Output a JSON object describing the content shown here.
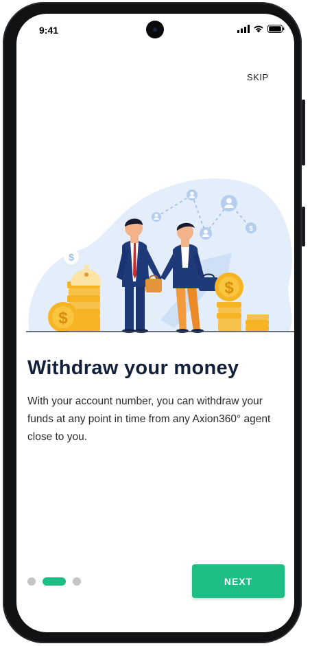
{
  "status_bar": {
    "time": "9:41"
  },
  "onboarding": {
    "skip_label": "SKIP",
    "title": "Withdraw your money",
    "description": "With  your account number, you can withdraw your funds at any point in time from any Axion360° agent close to you.",
    "next_label": "NEXT",
    "current_page": 2,
    "page_count": 3
  },
  "colors": {
    "accent": "#1dbf84",
    "title": "#13203a",
    "dot_inactive": "#c4c4c4",
    "coin": "#f6b324",
    "suit": "#1f3a78",
    "blob": "#e4eefb"
  },
  "icons": [
    "signal-icon",
    "wifi-icon",
    "battery-icon",
    "dollar-icon",
    "user-icon"
  ]
}
